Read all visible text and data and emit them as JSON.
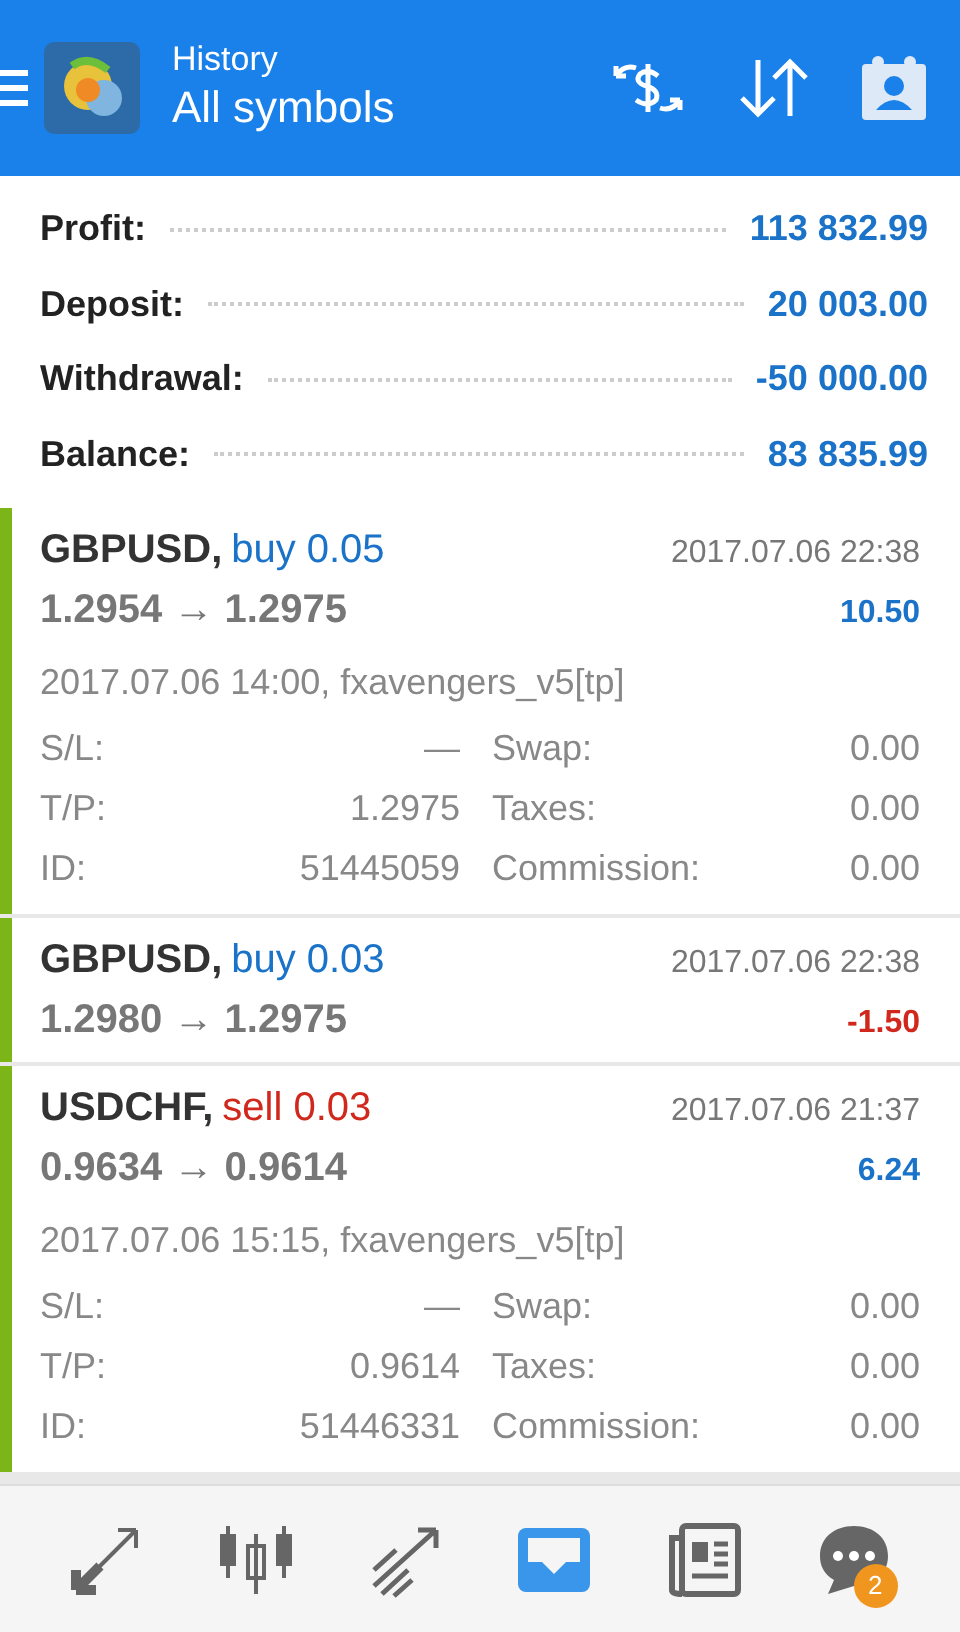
{
  "header": {
    "title": "History",
    "subtitle": "All symbols"
  },
  "summary": [
    {
      "label": "Profit:",
      "value": "113 832.99"
    },
    {
      "label": "Deposit:",
      "value": "20 003.00"
    },
    {
      "label": "Withdrawal:",
      "value": "-50 000.00"
    },
    {
      "label": "Balance:",
      "value": "83 835.99"
    }
  ],
  "trades": [
    {
      "symbol": "GBPUSD,",
      "sell": false,
      "order": "buy 0.05",
      "time": "2017.07.06 22:38",
      "prices": "1.2954 → 1.2975",
      "profit": "10.50",
      "loss": false,
      "expanded": true,
      "open_info": "2017.07.06 14:00, fxavengers_v5[tp]",
      "details": [
        {
          "label": "S/L:",
          "value": "—",
          "label_2": "Swap:",
          "value_2": "0.00"
        },
        {
          "label": "T/P:",
          "value": "1.2975",
          "label_2": "Taxes:",
          "value_2": "0.00"
        },
        {
          "label": "ID:",
          "value": "51445059",
          "label_2": "Commission:",
          "value_2": "0.00"
        }
      ]
    },
    {
      "symbol": "GBPUSD,",
      "sell": false,
      "order": "buy 0.03",
      "time": "2017.07.06 22:38",
      "prices": "1.2980 → 1.2975",
      "profit": "-1.50",
      "loss": true,
      "expanded": false
    },
    {
      "symbol": "USDCHF,",
      "sell": true,
      "order": "sell 0.03",
      "time": "2017.07.06 21:37",
      "prices": "0.9634 → 0.9614",
      "profit": "6.24",
      "loss": false,
      "expanded": true,
      "open_info": "2017.07.06 15:15, fxavengers_v5[tp]",
      "details": [
        {
          "label": "S/L:",
          "value": "—",
          "label_2": "Swap:",
          "value_2": "0.00"
        },
        {
          "label": "T/P:",
          "value": "0.9614",
          "label_2": "Taxes:",
          "value_2": "0.00"
        },
        {
          "label": "ID:",
          "value": "51446331",
          "label_2": "Commission:",
          "value_2": "0.00"
        }
      ]
    }
  ],
  "nav": [
    {
      "kind": "quotes",
      "selected": false
    },
    {
      "kind": "chart",
      "selected": false
    },
    {
      "kind": "trade",
      "selected": false
    },
    {
      "kind": "history",
      "selected": true
    },
    {
      "kind": "news",
      "selected": false
    },
    {
      "kind": "chat",
      "selected": false,
      "badge": "2"
    }
  ]
}
